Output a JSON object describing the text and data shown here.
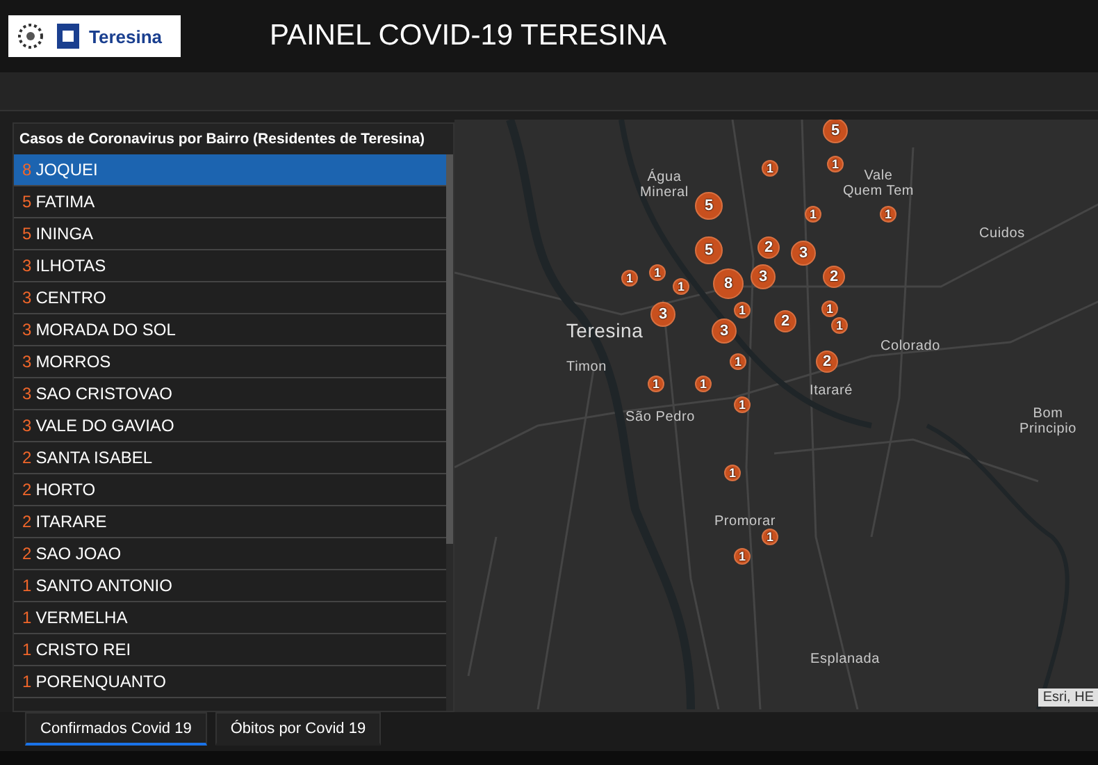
{
  "header": {
    "title": "PAINEL COVID-19 TERESINA",
    "logo_text": "Teresina"
  },
  "panel": {
    "title": "Casos de Coronavirus por Bairro (Residentes de Teresina)",
    "rows": [
      {
        "count": "8",
        "name": "JOQUEI",
        "selected": true
      },
      {
        "count": "5",
        "name": "FATIMA",
        "selected": false
      },
      {
        "count": "5",
        "name": "ININGA",
        "selected": false
      },
      {
        "count": "3",
        "name": "ILHOTAS",
        "selected": false
      },
      {
        "count": "3",
        "name": "CENTRO",
        "selected": false
      },
      {
        "count": "3",
        "name": "MORADA DO SOL",
        "selected": false
      },
      {
        "count": "3",
        "name": "MORROS",
        "selected": false
      },
      {
        "count": "3",
        "name": "SAO CRISTOVAO",
        "selected": false
      },
      {
        "count": "3",
        "name": "VALE DO GAVIAO",
        "selected": false
      },
      {
        "count": "2",
        "name": "SANTA ISABEL",
        "selected": false
      },
      {
        "count": "2",
        "name": "HORTO",
        "selected": false
      },
      {
        "count": "2",
        "name": "ITARARE",
        "selected": false
      },
      {
        "count": "2",
        "name": "SAO JOAO",
        "selected": false
      },
      {
        "count": "1",
        "name": "SANTO ANTONIO",
        "selected": false
      },
      {
        "count": "1",
        "name": "VERMELHA",
        "selected": false
      },
      {
        "count": "1",
        "name": "CRISTO REI",
        "selected": false
      },
      {
        "count": "1",
        "name": "PORENQUANTO",
        "selected": false
      }
    ]
  },
  "map": {
    "places": [
      "Água\nMineral",
      "Vale\nQuem Tem",
      "Cuidos",
      "Teresina",
      "Colorado",
      "Timon",
      "Itararé",
      "São Pedro",
      "Bom\nPrincipio",
      "Promorar",
      "Esplanada"
    ],
    "markers": [
      "5",
      "1",
      "1",
      "5",
      "1",
      "1",
      "5",
      "2",
      "3",
      "1",
      "1",
      "1",
      "8",
      "3",
      "2",
      "3",
      "3",
      "1",
      "2",
      "1",
      "1",
      "1",
      "2",
      "1",
      "1",
      "1",
      "1",
      "1",
      "1"
    ],
    "attribution": "Esri, HE"
  },
  "tabs": [
    {
      "label": "Confirmados Covid 19",
      "selected": true
    },
    {
      "label": "Óbitos por Covid 19",
      "selected": false
    }
  ]
}
